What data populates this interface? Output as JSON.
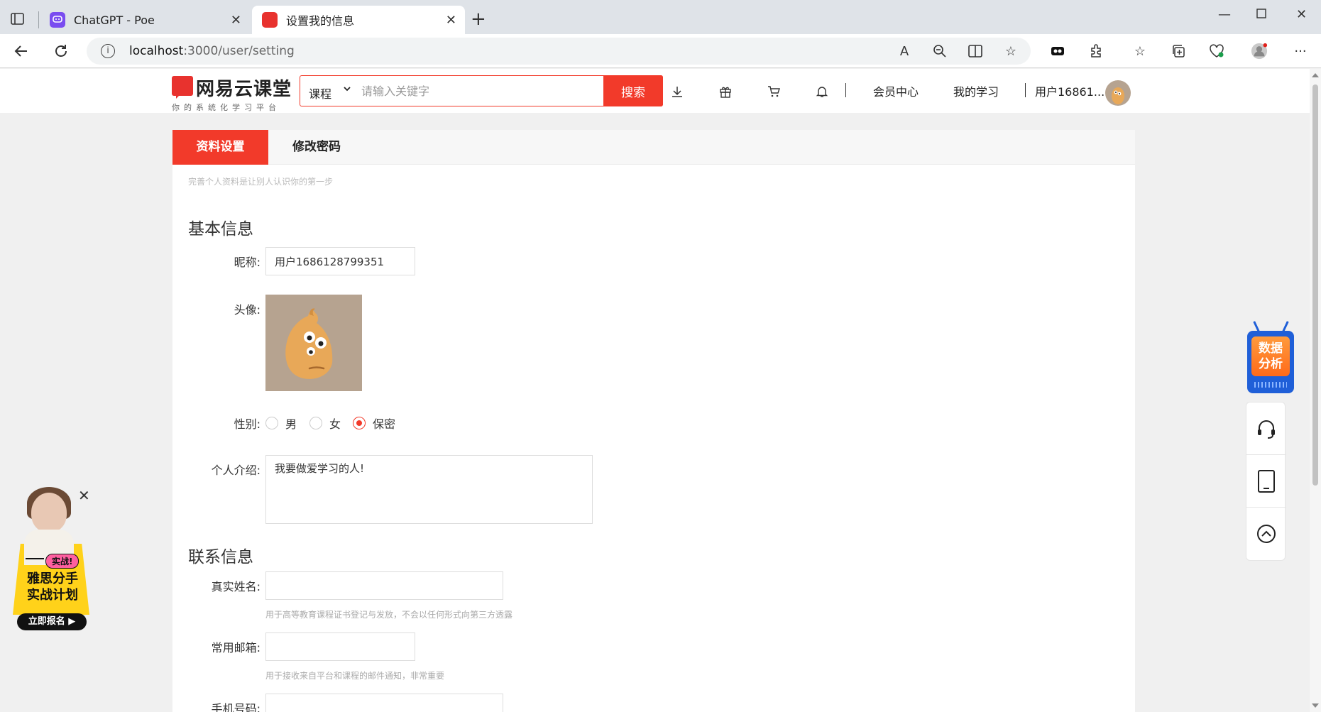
{
  "browser": {
    "tabs": [
      {
        "title": "ChatGPT - Poe",
        "active": false
      },
      {
        "title": "设置我的信息",
        "active": true
      }
    ],
    "url_host": "localhost",
    "url_path": ":3000/user/setting"
  },
  "header": {
    "logo_name": "网易云课堂",
    "logo_slogan": "你的系统化学习平台",
    "search_category": "课程",
    "search_placeholder": "请输入关键字",
    "search_button": "搜索",
    "member_center": "会员中心",
    "my_learning": "我的学习",
    "username": "用户16861..."
  },
  "settings": {
    "tabs": [
      "资料设置",
      "修改密码"
    ],
    "hint": "完善个人资料是让别人认识你的第一步",
    "basic_title": "基本信息",
    "nickname_label": "昵称:",
    "nickname_value": "用户1686128799351",
    "avatar_label": "头像:",
    "gender_label": "性别:",
    "gender_options": [
      "男",
      "女",
      "保密"
    ],
    "gender_selected": "保密",
    "bio_label": "个人介绍:",
    "bio_value": "我要做爱学习的人!",
    "contact_title": "联系信息",
    "realname_label": "真实姓名:",
    "realname_hint": "用于高等教育课程证书登记与发放，不会以任何形式向第三方透露",
    "email_label": "常用邮箱:",
    "email_hint": "用于接收来自平台和课程的邮件通知，非常重要",
    "phone_label": "手机号码:"
  },
  "floating": {
    "data_badge": [
      "数据",
      "分析"
    ]
  },
  "ad": {
    "tag": "实战!",
    "title_line1": "雅思分手",
    "title_line2": "实战计划",
    "cta": "立即报名"
  },
  "colors": {
    "brand_red": "#f23a2a",
    "badge_blue": "#1f5fd8"
  }
}
